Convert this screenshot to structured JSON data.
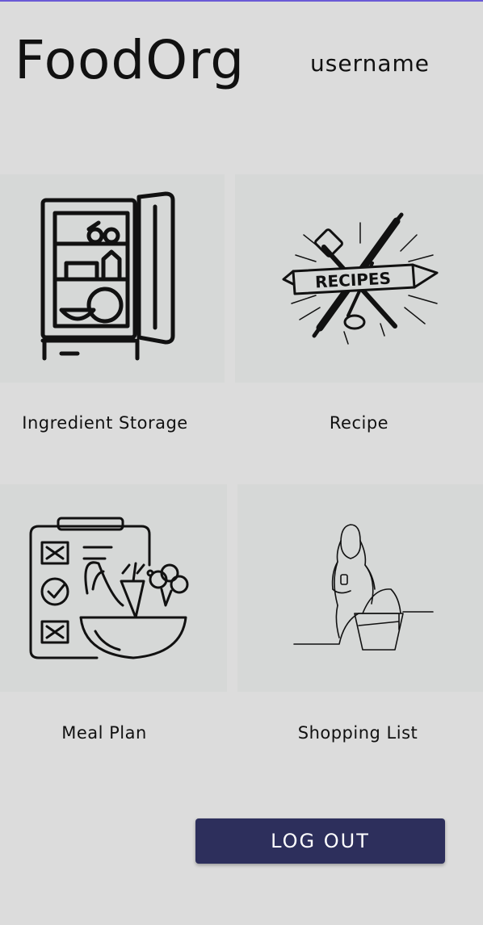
{
  "header": {
    "app_title": "FoodOrg",
    "username": "username"
  },
  "menu": {
    "items": [
      {
        "label": "Ingredient Storage",
        "icon": "fridge-icon"
      },
      {
        "label": "Recipe",
        "icon": "recipes-icon",
        "icon_text": "RECIPES"
      },
      {
        "label": "Meal Plan",
        "icon": "meal-plan-icon"
      },
      {
        "label": "Shopping List",
        "icon": "shopping-basket-icon"
      }
    ]
  },
  "actions": {
    "logout_label": "LOG OUT"
  },
  "colors": {
    "background": "#dcdcdc",
    "tile": "#d6d8d7",
    "logout_button": "#2d2f5c",
    "top_accent": "#6b5bd6"
  }
}
